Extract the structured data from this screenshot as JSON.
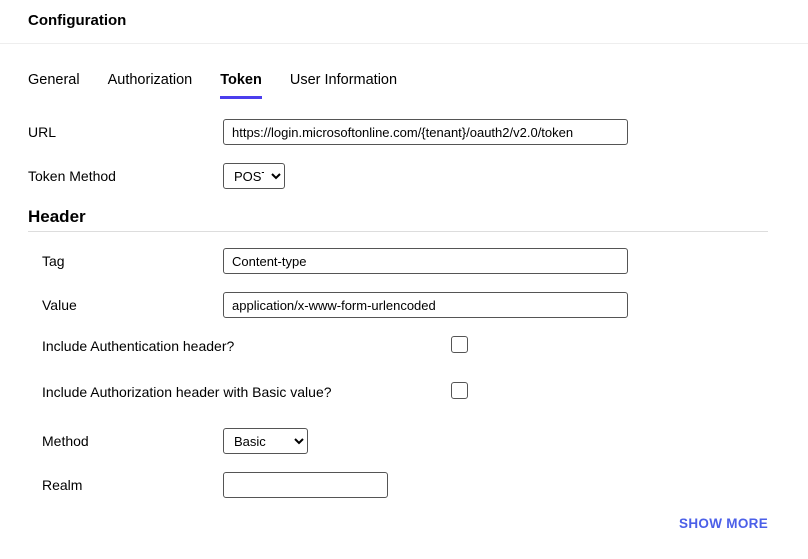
{
  "title": "Configuration",
  "tabs": {
    "general": "General",
    "authorization": "Authorization",
    "token": "Token",
    "user_information": "User Information",
    "active": "token"
  },
  "form": {
    "url_label": "URL",
    "url_value": "https://login.microsoftonline.com/{tenant}/oauth2/v2.0/token",
    "token_method_label": "Token Method",
    "token_method_value": "POST"
  },
  "header_section": {
    "title": "Header",
    "tag_label": "Tag",
    "tag_value": "Content-type",
    "value_label": "Value",
    "value_value": "application/x-www-form-urlencoded",
    "include_auth_header_label": "Include Authentication header?",
    "include_auth_header_checked": false,
    "include_basic_label": "Include Authorization header with Basic value?",
    "include_basic_checked": false,
    "method_label": "Method",
    "method_value": "Basic",
    "realm_label": "Realm",
    "realm_value": ""
  },
  "show_more": "SHOW MORE"
}
